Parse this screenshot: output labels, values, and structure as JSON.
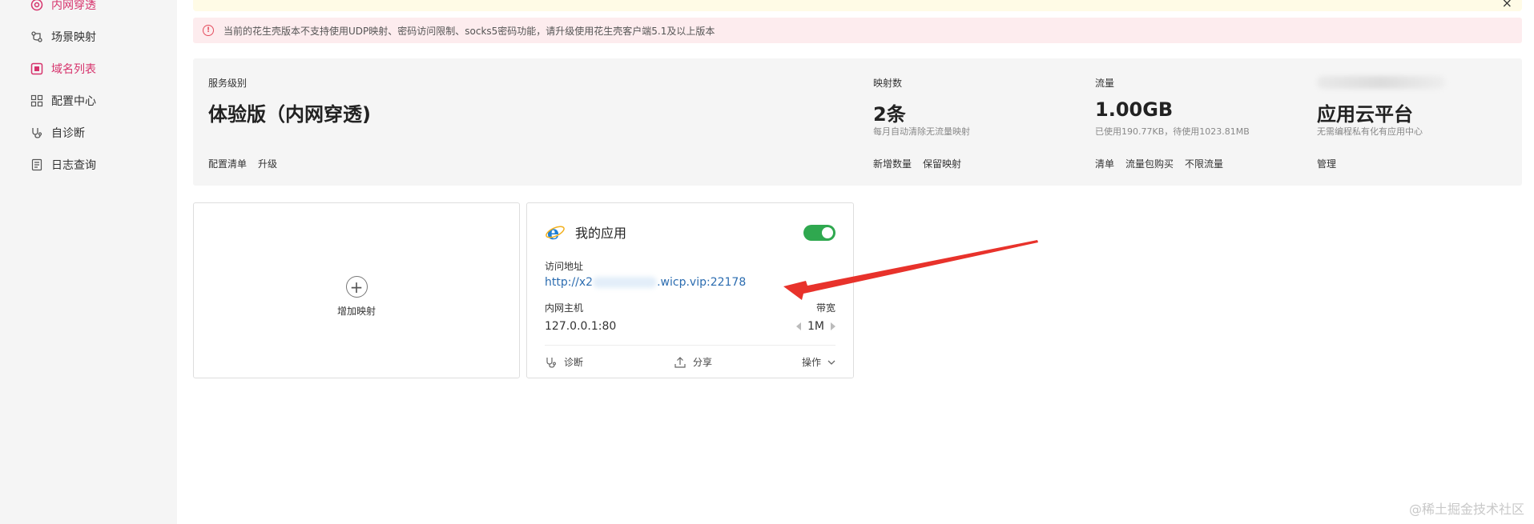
{
  "sidebar": {
    "items": [
      {
        "label": "内网穿透",
        "icon": "target-icon",
        "active": true
      },
      {
        "label": "场景映射",
        "icon": "branch-icon",
        "active": false
      },
      {
        "label": "域名列表",
        "icon": "domain-icon",
        "active": true
      },
      {
        "label": "配置中心",
        "icon": "grid-icon",
        "active": false
      },
      {
        "label": "自诊断",
        "icon": "stethoscope-icon",
        "active": false
      },
      {
        "label": "日志查询",
        "icon": "document-icon",
        "active": false
      }
    ]
  },
  "notice": {
    "text": "当前的花生壳版本不支持使用UDP映射、密码访问限制、socks5密码功能，请升级使用花生壳客户端5.1及以上版本"
  },
  "summary": {
    "service": {
      "label": "服务级别",
      "value": "体验版（内网穿透)",
      "links": [
        "配置清单",
        "升级"
      ]
    },
    "mappings": {
      "label": "映射数",
      "value": "2条",
      "sub": "每月自动清除无流量映射",
      "links": [
        "新增数量",
        "保留映射"
      ]
    },
    "traffic": {
      "label": "流量",
      "value": "1.00GB",
      "sub": "已使用190.77KB，待使用1023.81MB",
      "links": [
        "清单",
        "流量包购买",
        "不限流量"
      ]
    },
    "cloud": {
      "value": "应用云平台",
      "sub": "无需编程私有化有应用中心",
      "links": [
        "管理"
      ]
    }
  },
  "add_card": {
    "label": "增加映射"
  },
  "app_card": {
    "title": "我的应用",
    "enabled": true,
    "url_label": "访问地址",
    "url_prefix": "http://x2",
    "url_suffix": ".wicp.vip:22178",
    "host_label": "内网主机",
    "host": "127.0.0.1:80",
    "bw_label": "带宽",
    "bw": "1M",
    "actions": {
      "diagnose": "诊断",
      "share": "分享",
      "ops": "操作"
    }
  },
  "colors": {
    "accent": "#d6336c",
    "toggle": "#2fa84f",
    "link": "#2b6cb0",
    "alert_bg": "#fdecee"
  },
  "watermark": "@稀土掘金技术社区"
}
